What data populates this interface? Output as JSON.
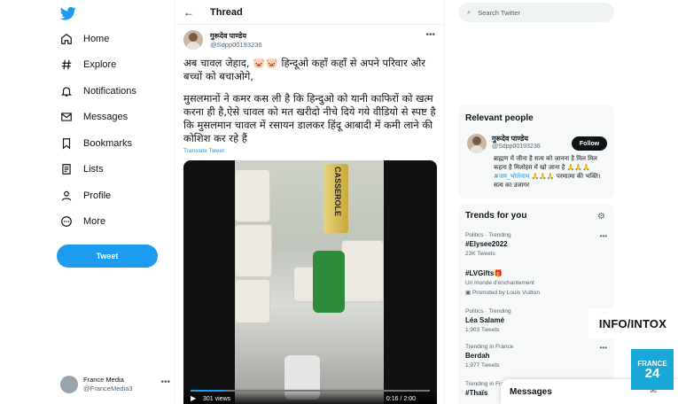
{
  "nav": {
    "items": [
      {
        "label": "Home",
        "icon": "home-icon"
      },
      {
        "label": "Explore",
        "icon": "hashtag-icon"
      },
      {
        "label": "Notifications",
        "icon": "bell-icon"
      },
      {
        "label": "Messages",
        "icon": "mail-icon"
      },
      {
        "label": "Bookmarks",
        "icon": "bookmark-icon"
      },
      {
        "label": "Lists",
        "icon": "list-icon"
      },
      {
        "label": "Profile",
        "icon": "person-icon"
      },
      {
        "label": "More",
        "icon": "more-circle-icon"
      }
    ],
    "tweet_button": "Tweet",
    "account": {
      "name": "France Media",
      "handle": "@FranceMedia3"
    }
  },
  "thread": {
    "title": "Thread",
    "tweet": {
      "name": "गुरूदेव पाण्डेय",
      "handle": "@Sdpp00193236",
      "text1": "अब चावल जेहाद, 🐷🐷 हिन्दूओ कहाँ कहाँ से अपने परिवार और बच्चों को बचाओगे,",
      "text2": "मुसलमानों ने कमर कस ली है कि हिन्दुओ को यानी काफिरों को खत्म करना ही है,ऐसे चावल को मत खरीदो नीचे दिये गये वीडियो से स्पष्ट है कि मुसलमान चावल में रसायन डालकर हिंदू आबादी में कमी लाने की कोशिश कर रहे हैं",
      "translate": "Translate Tweet",
      "video": {
        "views": "301 views",
        "time": "0:16 / 2:00",
        "bag_text": "CASSEROLE",
        "progress": 0.14
      }
    }
  },
  "search": {
    "placeholder": "Search Twitter"
  },
  "relevant": {
    "title": "Relevant people",
    "name": "गुरूदेव पाण्डेय",
    "handle": "@Sdpp00193236",
    "follow": "Follow",
    "bio": "ब्राह्मण में जीना है सत्य को जानना है मिल मिल कहना है मिलोहम में खो जाना है 🙏🙏🙏",
    "bio_link": "#जय_भोलेनाथ 🙏🙏🙏",
    "bio_end": "परमात्मा की भक्ति।सत्य का उजागर"
  },
  "trends": {
    "title": "Trends for you",
    "items": [
      {
        "ctx": "Politics · Trending",
        "name": "#Elysee2022",
        "cnt": "23K Tweets"
      },
      {
        "ctx": "",
        "name": "#LVGifts🎁",
        "cnt": "Un monde d'enchantement",
        "extra": "Promoted by Louis Vuitton"
      },
      {
        "ctx": "Politics · Trending",
        "name": "Léa Salamé",
        "cnt": "1,903 Tweets"
      },
      {
        "ctx": "Trending in France",
        "name": "Berdah",
        "cnt": "1,977 Tweets"
      },
      {
        "ctx": "Trending in France",
        "name": "#Thaïs",
        "cnt": ""
      }
    ]
  },
  "messages": {
    "label": "Messages"
  },
  "overlay": {
    "info": "INFO/INTOX",
    "brand_a": "FRANCE",
    "brand_b": "24"
  },
  "colors": {
    "accent": "#1d9bf0",
    "brand": "#1aa8d8"
  }
}
